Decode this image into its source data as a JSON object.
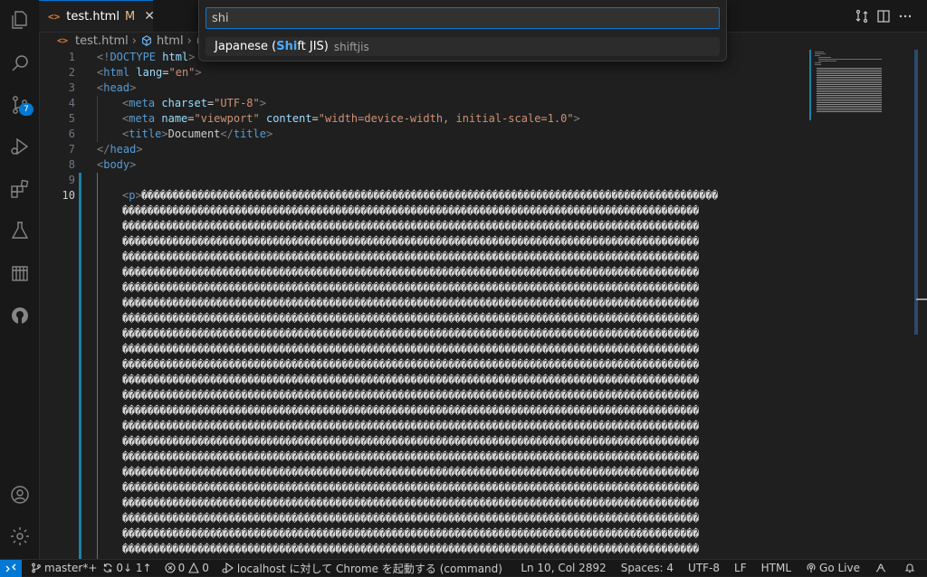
{
  "tab": {
    "icon": "<>",
    "name": "test.html",
    "modified": "M",
    "close": "✕"
  },
  "breadcrumbs": {
    "file": "test.html",
    "symbol": "html"
  },
  "quickpick": {
    "input_value": "shi",
    "item": {
      "pre": "Japanese (",
      "match": "Shi",
      "post": "ft JIS)",
      "description": "shiftjis"
    }
  },
  "activity": {
    "scm_badge": "7"
  },
  "editor": {
    "line_numbers": [
      "1",
      "2",
      "3",
      "4",
      "5",
      "6",
      "7",
      "8",
      "9",
      "10"
    ],
    "active_line": "10",
    "lines": {
      "l1": {
        "open": "<!",
        "tag": "DOCTYPE",
        "attr": " html",
        "close": ">"
      },
      "l2": {
        "open": "<",
        "tag": "html",
        "attr": " lang",
        "eq": "=",
        "str": "\"en\"",
        "close": ">"
      },
      "l3": {
        "open": "<",
        "tag": "head",
        "close": ">"
      },
      "l4": {
        "open": "<",
        "tag": "meta",
        "attr": " charset",
        "eq": "=",
        "str": "\"UTF-8\"",
        "close": ">"
      },
      "l5": {
        "open": "<",
        "tag": "meta",
        "attr1": " name",
        "eq1": "=",
        "str1": "\"viewport\"",
        "attr2": " content",
        "eq2": "=",
        "str2": "\"width=device-width, initial-scale=1.0\"",
        "close": ">"
      },
      "l6": {
        "open": "<",
        "tag": "title",
        "close": ">",
        "text": "Document",
        "open2": "</",
        "tag2": "title",
        "close2": ">"
      },
      "l7": {
        "open": "</",
        "tag": "head",
        "close": ">"
      },
      "l8": {
        "open": "<",
        "tag": "body",
        "close": ">"
      },
      "l10": {
        "open": "<",
        "tag": "p",
        "close": ">"
      }
    },
    "garbled_row": "��������������������������������������������������������������������������������������������"
  },
  "status": {
    "branch": "master*+",
    "sync": "0↓ 1↑",
    "errors": "0",
    "warnings": "0",
    "launch": "localhost に対して Chrome を起動する (command)",
    "position": "Ln 10, Col 2892",
    "spaces": "Spaces: 4",
    "encoding": "UTF-8",
    "eol": "LF",
    "language": "HTML",
    "golive": "Go Live"
  }
}
